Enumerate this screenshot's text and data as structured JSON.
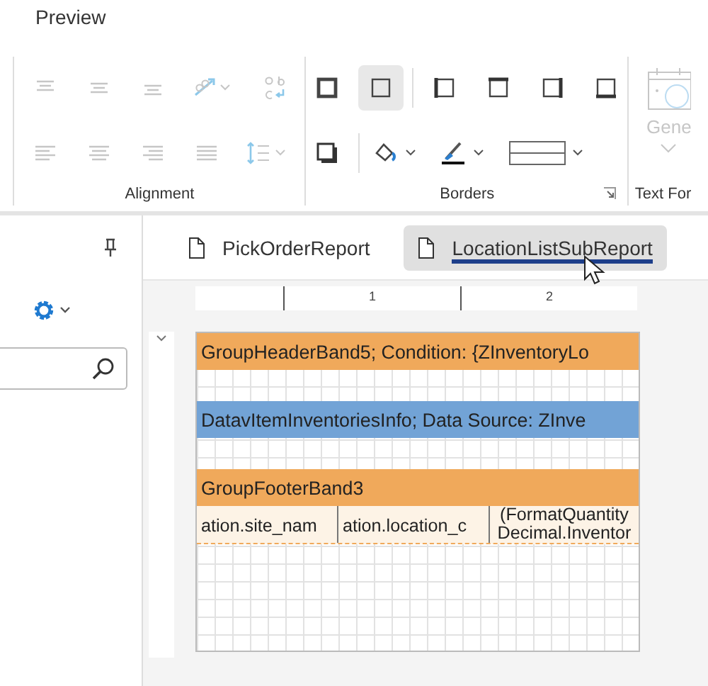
{
  "header": {
    "title": "Preview"
  },
  "ribbon": {
    "alignment": {
      "label": "Alignment",
      "disabled": true
    },
    "borders": {
      "label": "Borders",
      "buttons": [
        {
          "selected": false
        },
        {
          "selected": true
        },
        {
          "selected": false
        },
        {
          "selected": false
        },
        {
          "selected": false
        },
        {
          "selected": false
        }
      ]
    },
    "text_format": {
      "label": "Text For",
      "button_label": "Gene",
      "disabled": true
    }
  },
  "tabs": [
    {
      "label": "PickOrderReport",
      "selected": false
    },
    {
      "label": "LocationListSubReport",
      "selected": true
    }
  ],
  "ruler": {
    "labels": [
      "1",
      "2"
    ]
  },
  "bands": [
    {
      "kind": "header",
      "text": "GroupHeaderBand5; Condition: {ZInventoryLo"
    },
    {
      "kind": "data",
      "text": "DatavItemInventoriesInfo; Data Source: ZInve"
    },
    {
      "kind": "footer",
      "text": "GroupFooterBand3"
    }
  ],
  "fields": [
    {
      "lines": [
        "ation.site_nam"
      ]
    },
    {
      "lines": [
        "ation.location_c"
      ]
    },
    {
      "lines": [
        "(FormatQuantity",
        "Decimal.Inventor"
      ]
    }
  ]
}
